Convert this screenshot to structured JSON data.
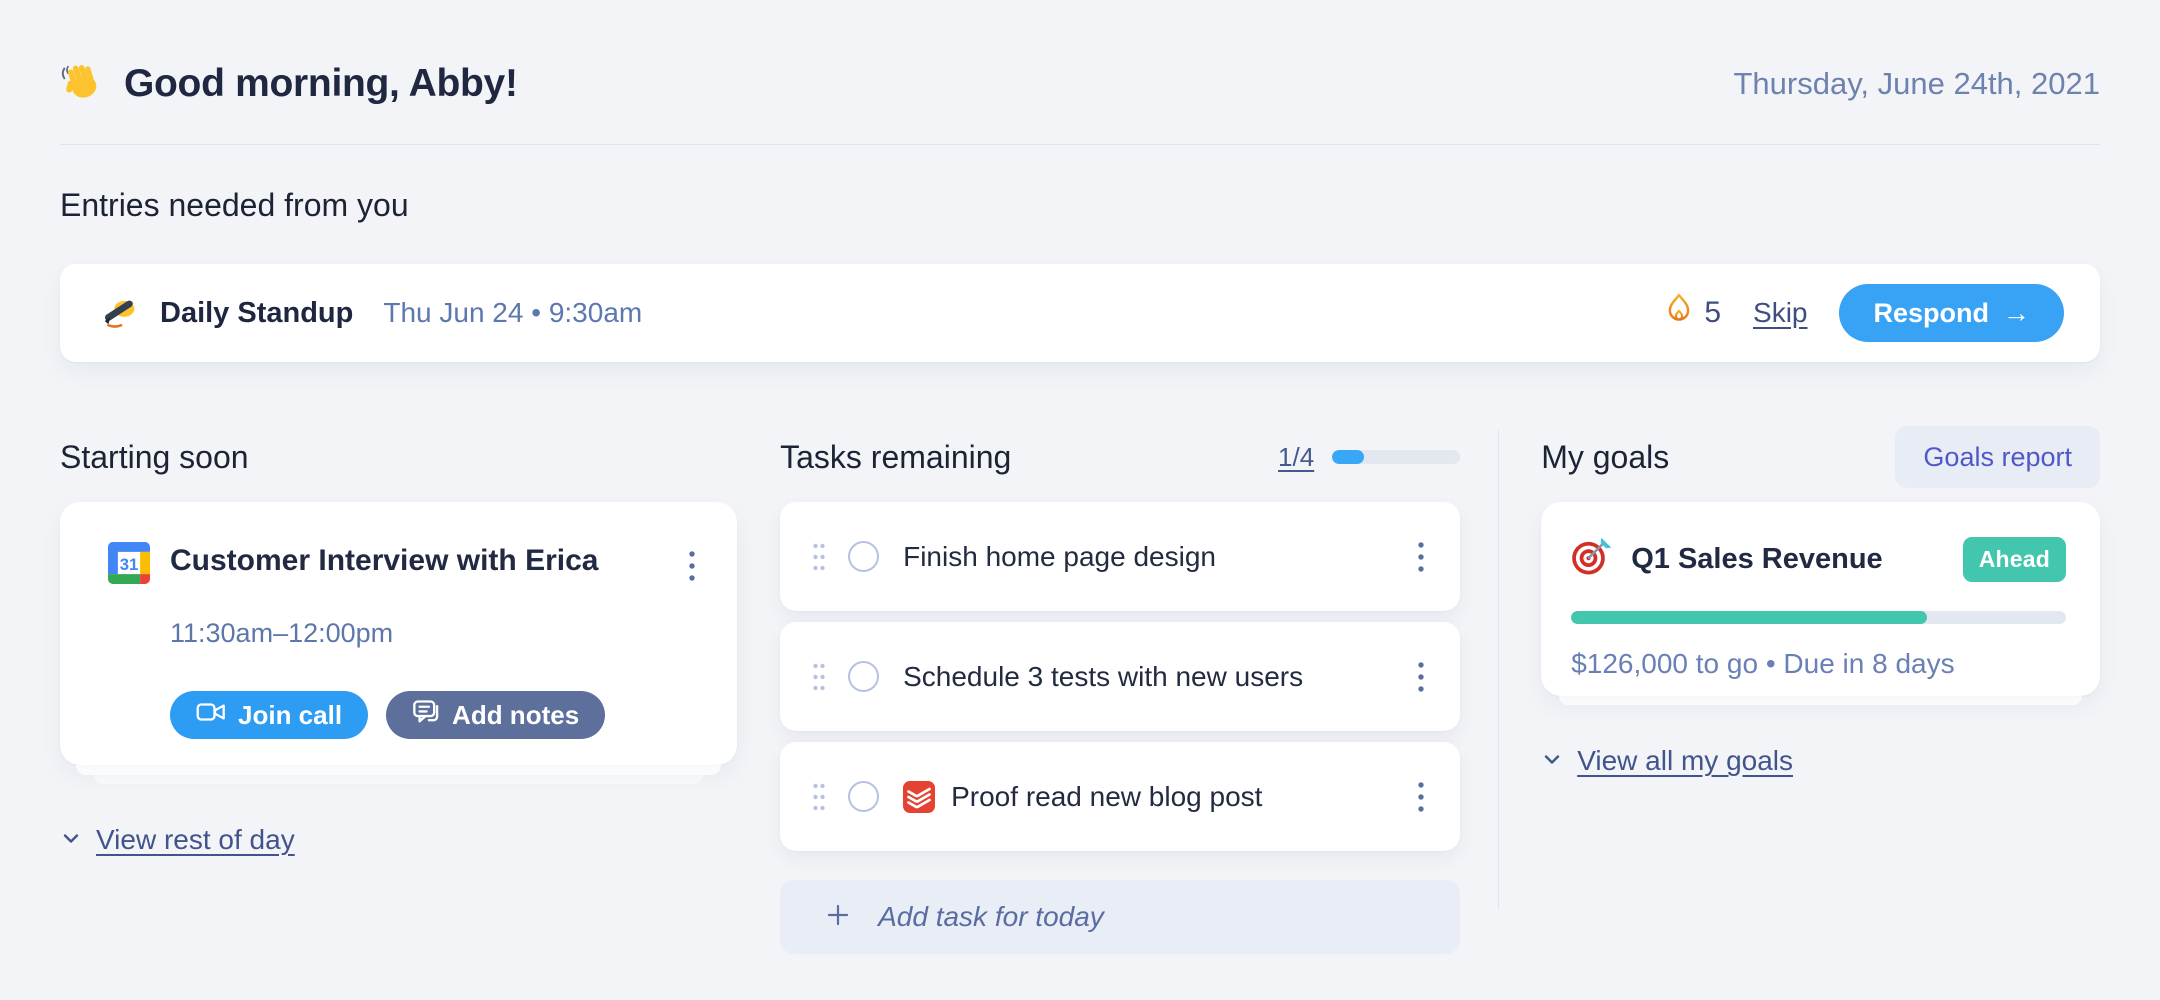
{
  "header": {
    "wave_icon": "waving-hand-icon",
    "greeting": "Good morning, Abby!",
    "date": "Thursday, June 24th, 2021"
  },
  "entries": {
    "heading": "Entries needed from you",
    "standup": {
      "icon": "writing-hand-icon",
      "title": "Daily Standup",
      "schedule": "Thu Jun 24 • 9:30am",
      "streak_icon": "flame-icon",
      "streak_count": "5",
      "skip_label": "Skip",
      "respond_label": "Respond",
      "respond_arrow": "→"
    }
  },
  "starting_soon": {
    "heading": "Starting soon",
    "event": {
      "calendar_icon": "google-calendar-icon",
      "calendar_day": "31",
      "title": "Customer Interview with Erica",
      "time": "11:30am–12:00pm",
      "join_icon": "video-camera-icon",
      "join_label": "Join call",
      "notes_icon": "chat-notes-icon",
      "notes_label": "Add notes",
      "menu_icon": "kebab-menu-icon"
    },
    "view_link": "View rest of day"
  },
  "tasks": {
    "heading": "Tasks remaining",
    "progress_label": "1/4",
    "progress_pct": 25,
    "items": [
      {
        "label": "Finish home page design"
      },
      {
        "label": "Schedule 3 tests with new users"
      },
      {
        "label": "Proof read new blog post",
        "source_icon": "todoist-icon"
      }
    ],
    "add_icon": "plus-icon",
    "add_label": "Add task for today"
  },
  "goals": {
    "heading": "My goals",
    "report_label": "Goals report",
    "goal": {
      "icon": "dart-target-icon",
      "title": "Q1 Sales Revenue",
      "badge": "Ahead",
      "progress_pct": 72,
      "status": "$126,000 to go • Due in 8 days"
    },
    "view_link": "View all my goals"
  },
  "colors": {
    "page_bg": "#f2f4f8",
    "primary_blue": "#38a3f5",
    "join_blue": "#2d9cf3",
    "slate_button": "#5d6f9b",
    "teal_success": "#42c7ae",
    "todoist_red": "#e44332",
    "link_slate": "#42548c",
    "text_dark": "#1f2840",
    "text_blue_gray": "#6a80b4",
    "flame_orange": "#ef8c1a"
  }
}
